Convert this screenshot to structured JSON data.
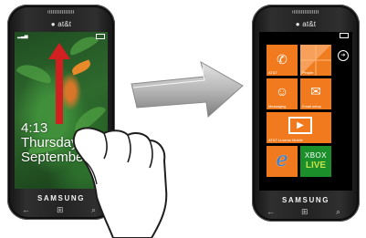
{
  "left_phone": {
    "carrier": "● at&t",
    "time": "4:13",
    "day": "Thursday",
    "date": "September 23",
    "brand": "SAMSUNG",
    "keys": {
      "back": "←",
      "start": "⊞",
      "search": "⌕"
    }
  },
  "right_phone": {
    "carrier": "● at&t",
    "brand": "SAMSUNG",
    "keys": {
      "back": "←",
      "start": "⊞",
      "search": "⌕"
    },
    "tiles": {
      "phone": {
        "label": "AT&T",
        "icon": "✆"
      },
      "people": {
        "label": "People"
      },
      "messaging": {
        "label": "Messaging",
        "icon": "☺"
      },
      "email": {
        "label": "Email setup",
        "icon": "✉"
      },
      "video": {
        "label": "AT&T U-verse Mobile",
        "icon": "▶"
      },
      "ie": {
        "label": "",
        "icon": "e"
      },
      "xbox": {
        "line1": "XBOX",
        "line2": "LIVE"
      }
    },
    "nav_arrow": "➔"
  },
  "colors": {
    "tile": "#f07a1d",
    "arrow": "#d21f1f",
    "xbox_bg": "#1a8f2a",
    "xbox_live": "#c6e04a"
  }
}
